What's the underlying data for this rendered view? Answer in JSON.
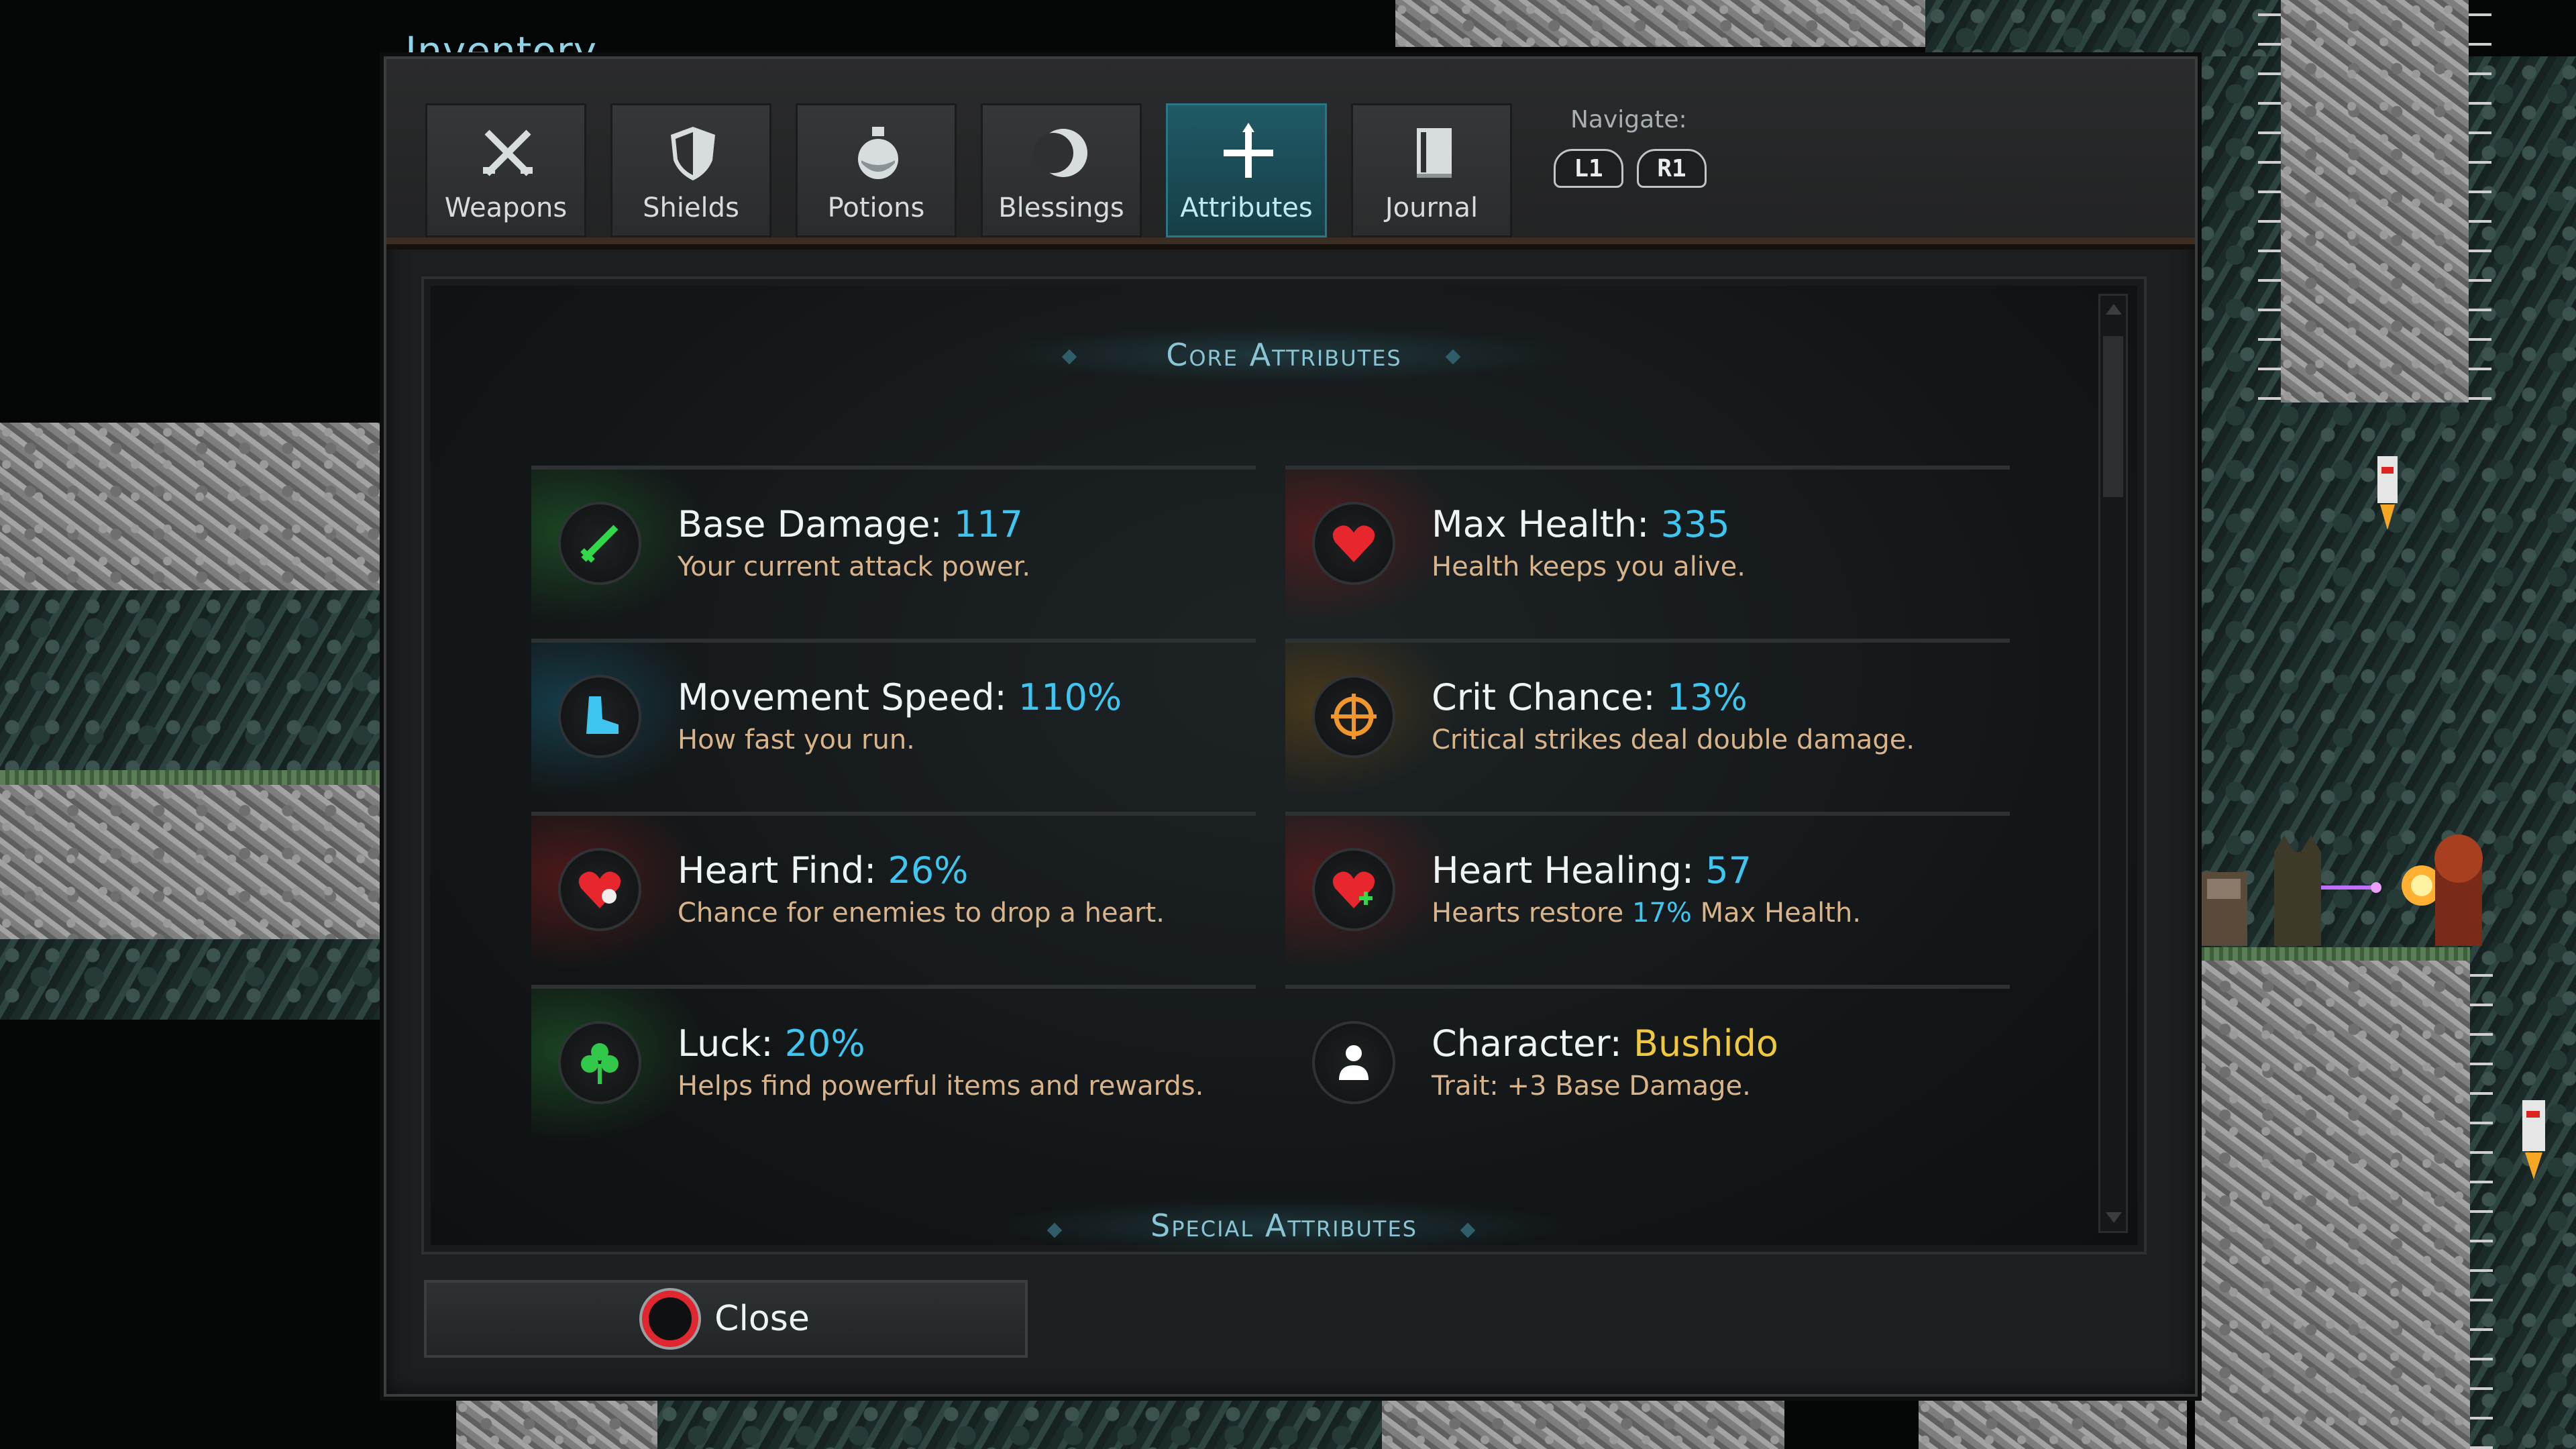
{
  "window": {
    "title": "Inventory"
  },
  "tabs": [
    {
      "label": "Weapons",
      "icon": "crossed-swords-icon",
      "active": false
    },
    {
      "label": "Shields",
      "icon": "shield-icon",
      "active": false
    },
    {
      "label": "Potions",
      "icon": "potion-icon",
      "active": false
    },
    {
      "label": "Blessings",
      "icon": "crescent-eye-icon",
      "active": false
    },
    {
      "label": "Attributes",
      "icon": "cross-arrows-icon",
      "active": true
    },
    {
      "label": "Journal",
      "icon": "book-icon",
      "active": false
    }
  ],
  "navigate": {
    "label": "Navigate:",
    "left_button": "L1",
    "right_button": "R1"
  },
  "sections": {
    "core": "Core Attributes",
    "special": "Special Attributes"
  },
  "attributes": [
    {
      "name": "Base Damage:",
      "value": "117",
      "desc": "Your current attack power.",
      "icon": "sword-icon",
      "glow": "#1f6a2a"
    },
    {
      "name": "Max Health:",
      "value": "335",
      "desc": "Health keeps you alive.",
      "icon": "heart-icon",
      "glow": "#7a1a1a"
    },
    {
      "name": "Movement Speed:",
      "value": "110%",
      "desc": "How fast you run.",
      "icon": "boot-icon",
      "glow": "#165a70"
    },
    {
      "name": "Crit Chance:",
      "value": "13%",
      "desc": "Critical strikes deal double damage.",
      "icon": "crosshair-icon",
      "glow": "#6a4a12"
    },
    {
      "name": "Heart Find:",
      "value": "26%",
      "desc": "Chance for enemies to drop a heart.",
      "icon": "heart-find-icon",
      "glow": "#7a1a1a"
    },
    {
      "name": "Heart Healing:",
      "value": "57",
      "desc_before": "Hearts restore ",
      "desc_highlight": "17%",
      "desc_after": " Max Health.",
      "icon": "heart-heal-icon",
      "glow": "#7a1a1a"
    },
    {
      "name": "Luck:",
      "value": "20%",
      "desc": "Helps find powerful items and rewards.",
      "icon": "clover-icon",
      "glow": "#1f6a2a"
    },
    {
      "name": "Character:",
      "value": "Bushido",
      "desc": "Trait: +3 Base Damage.",
      "icon": "person-icon",
      "glow": "#2a2d2e"
    }
  ],
  "close": {
    "label": "Close",
    "button_glyph": "circle-button-icon"
  },
  "colors": {
    "accent": "#3ec6f0",
    "desc": "#d9b48a",
    "gold": "#f0c83e",
    "active_tab": "#1f5a66"
  }
}
